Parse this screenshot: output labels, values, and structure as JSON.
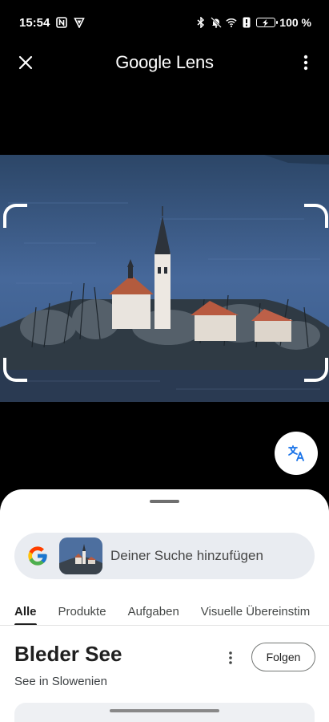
{
  "status_bar": {
    "time": "15:54",
    "battery_percent": "100 %",
    "left_icons": [
      "nfc-icon",
      "vpn-shield-icon"
    ],
    "right_icons": [
      "bluetooth-icon",
      "mute-bell-icon",
      "wifi-icon",
      "alert-icon",
      "battery-charging-icon"
    ]
  },
  "app_bar": {
    "title_google": "Google",
    "title_lens": "Lens",
    "close_icon": "close-icon",
    "more_icon": "more-vert-icon"
  },
  "translate_button": {
    "icon": "translate-icon"
  },
  "sheet": {
    "search": {
      "placeholder": "Deiner Suche hinzufügen"
    },
    "tabs": [
      {
        "label": "Alle",
        "active": true
      },
      {
        "label": "Produkte",
        "active": false
      },
      {
        "label": "Aufgaben",
        "active": false
      },
      {
        "label": "Visuelle Übereinstim",
        "active": false
      }
    ],
    "result": {
      "title": "Bleder See",
      "subtitle": "See in Slowenien",
      "follow_label": "Folgen"
    }
  },
  "colors": {
    "background": "#000000",
    "sheet": "#ffffff",
    "search_pill": "#e9ecf1",
    "lake_blue": "#3f5f8a"
  }
}
